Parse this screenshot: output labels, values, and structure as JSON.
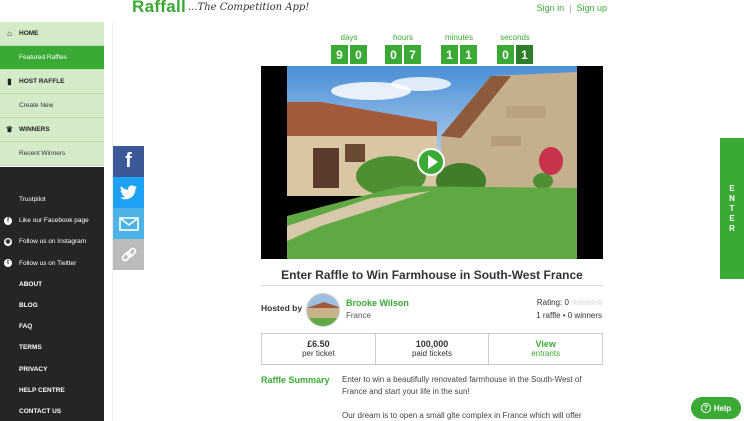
{
  "header": {
    "logo": "Raffall",
    "tagline": "...The Competition App!",
    "sign_in": "Sign in",
    "separator": "|",
    "sign_up": "Sign up"
  },
  "sidebar": {
    "home": "HOME",
    "featured": "Featured Raffles",
    "host": "HOST RAFFLE",
    "create": "Create New",
    "winners": "WINNERS",
    "recent": "Recent Winners",
    "trustpilot": "Trustpilot",
    "facebook": "Like our Facebook page",
    "instagram": "Follow us on Instagram",
    "twitter": "Follow us on Twitter",
    "about": "ABOUT",
    "blog": "BLOG",
    "faq": "FAQ",
    "terms": "TERMS",
    "privacy": "PRIVACY",
    "help_centre": "HELP CENTRE",
    "contact": "CONTACT US"
  },
  "countdown": {
    "days_label": "days",
    "days": [
      "9",
      "0"
    ],
    "hours_label": "hours",
    "hours": [
      "0",
      "7"
    ],
    "minutes_label": "minutes",
    "minutes": [
      "1",
      "1"
    ],
    "seconds_label": "seconds",
    "seconds": [
      "0",
      "1"
    ]
  },
  "raffle": {
    "title": "Enter Raffle to Win Farmhouse in South-West France",
    "hosted_by": "Hosted by",
    "host_name": "Brooke Wilson",
    "host_location": "France",
    "rating": "Rating: 0",
    "raffles_winners": "1 raffle • 0 winners",
    "price": "£6.50",
    "price_sub": "per ticket",
    "tickets": "100,000",
    "tickets_sub": "paid tickets",
    "entrants": "View",
    "entrants_sub": "entrants",
    "summary_label": "Raffle Summary",
    "summary_1": "Enter to win a beautifully renovated farmhouse in the South-West of France and start your life in the sun!",
    "summary_2": "Our dream is to open a small glte complex in France which will offer"
  },
  "enter_tab": [
    "E",
    "N",
    "T",
    "E",
    "R"
  ],
  "help_label": "Help",
  "colors": {
    "brand_green": "#3aaa35",
    "sidebar_light": "#d4ebc9",
    "sidebar_dark": "#252525"
  }
}
